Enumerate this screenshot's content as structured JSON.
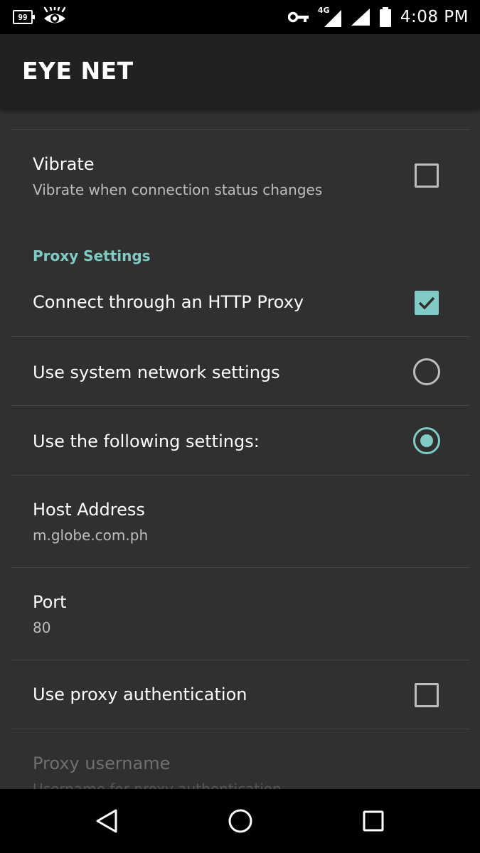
{
  "status_bar": {
    "battery_saver_label": "99",
    "time": "4:08 PM",
    "network_type": "4G",
    "icons": [
      "battery-saver-icon",
      "eye-icon",
      "vpn-key-icon",
      "cellular-signal-icon",
      "wifi-signal-icon",
      "battery-icon"
    ]
  },
  "app_bar": {
    "title": "EYE NET"
  },
  "preferences": {
    "vibrate": {
      "title": "Vibrate",
      "summary": "Vibrate when connection status changes",
      "checked": false
    },
    "proxy_category": "Proxy Settings",
    "http_proxy": {
      "title": "Connect through an HTTP Proxy",
      "checked": true
    },
    "system_network": {
      "title": "Use system network settings",
      "selected": false
    },
    "following_settings": {
      "title": "Use the following settings:",
      "selected": true
    },
    "host_address": {
      "title": "Host Address",
      "value": "m.globe.com.ph"
    },
    "port": {
      "title": "Port",
      "value": "80"
    },
    "proxy_auth": {
      "title": "Use proxy authentication",
      "checked": false
    },
    "proxy_username": {
      "title": "Proxy username",
      "summary": "Username for proxy authentication",
      "enabled": false
    }
  },
  "nav_bar": {
    "icons": [
      "back-icon",
      "home-icon",
      "recents-icon"
    ]
  },
  "colors": {
    "accent": "#80cbc4",
    "background": "#303030",
    "app_bar": "#212121",
    "status_bar": "#000000"
  }
}
